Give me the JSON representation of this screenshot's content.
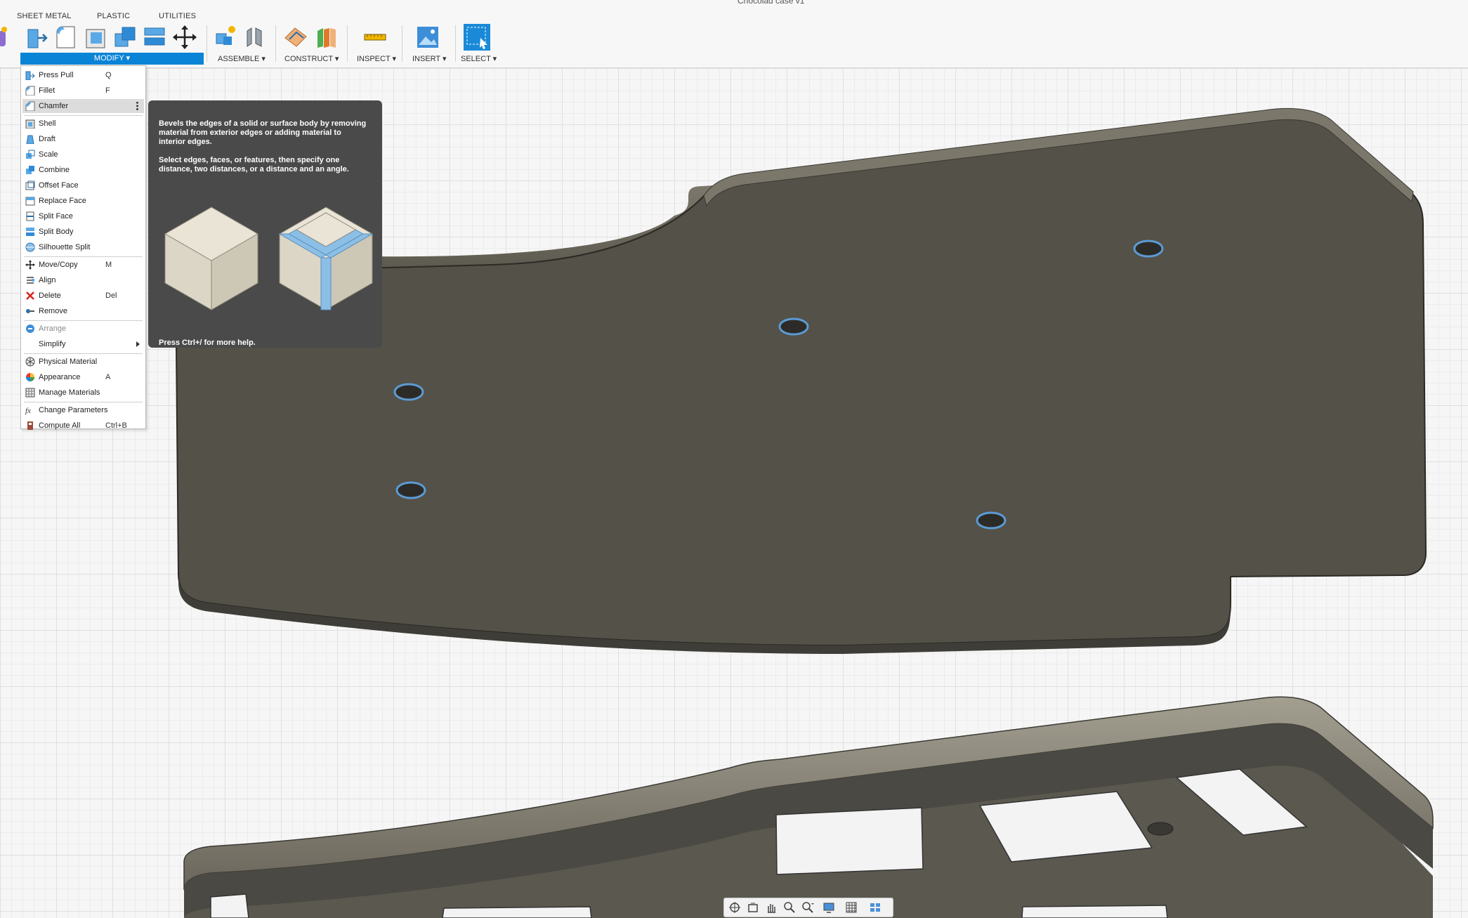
{
  "window": {
    "title": "Chocolad case v1"
  },
  "ribbon": {
    "tabs": [
      "SHEET METAL",
      "PLASTIC",
      "UTILITIES"
    ],
    "groups": {
      "modify": "MODIFY ▾",
      "assemble": "ASSEMBLE ▾",
      "construct": "CONSTRUCT ▾",
      "inspect": "INSPECT ▾",
      "insert": "INSERT ▾",
      "select": "SELECT ▾"
    },
    "tool_icons": [
      "press-pull-icon",
      "fillet-icon",
      "shell-icon",
      "combine-icon",
      "split-icon",
      "move-icon",
      "new-component-icon",
      "joint-icon",
      "offset-plane-icon",
      "midplane-icon",
      "measure-icon",
      "insert-image-icon",
      "select-window-icon"
    ]
  },
  "modify_menu": {
    "items": [
      {
        "label": "Press Pull",
        "key": "Q",
        "icon": "press-pull-icon"
      },
      {
        "label": "Fillet",
        "key": "F",
        "icon": "fillet-icon"
      },
      {
        "label": "Chamfer",
        "key": "",
        "icon": "chamfer-icon"
      },
      {
        "label": "Shell",
        "key": "",
        "icon": "shell-icon"
      },
      {
        "label": "Draft",
        "key": "",
        "icon": "draft-icon"
      },
      {
        "label": "Scale",
        "key": "",
        "icon": "scale-icon"
      },
      {
        "label": "Combine",
        "key": "",
        "icon": "combine-icon"
      },
      {
        "label": "Offset Face",
        "key": "",
        "icon": "offset-face-icon"
      },
      {
        "label": "Replace Face",
        "key": "",
        "icon": "replace-face-icon"
      },
      {
        "label": "Split Face",
        "key": "",
        "icon": "split-face-icon"
      },
      {
        "label": "Split Body",
        "key": "",
        "icon": "split-body-icon"
      },
      {
        "label": "Silhouette Split",
        "key": "",
        "icon": "silhouette-split-icon"
      },
      {
        "label": "Move/Copy",
        "key": "M",
        "icon": "move-copy-icon"
      },
      {
        "label": "Align",
        "key": "",
        "icon": "align-icon"
      },
      {
        "label": "Delete",
        "key": "Del",
        "icon": "delete-icon"
      },
      {
        "label": "Remove",
        "key": "",
        "icon": "remove-icon"
      },
      {
        "label": "Arrange",
        "key": "",
        "icon": "arrange-icon"
      },
      {
        "label": "Simplify",
        "key": "",
        "icon": "simplify-icon"
      },
      {
        "label": "Physical Material",
        "key": "",
        "icon": "physical-material-icon"
      },
      {
        "label": "Appearance",
        "key": "A",
        "icon": "appearance-icon"
      },
      {
        "label": "Manage Materials",
        "key": "",
        "icon": "manage-materials-icon"
      },
      {
        "label": "Change Parameters",
        "key": "",
        "icon": "change-parameters-icon"
      },
      {
        "label": "Compute All",
        "key": "Ctrl+B",
        "icon": "compute-all-icon"
      }
    ],
    "highlighted": "Chamfer",
    "disabled": [
      "Arrange"
    ]
  },
  "tooltip": {
    "paragraph1": "Bevels the edges of a solid or surface body by removing material from exterior edges or adding material to interior edges.",
    "paragraph2": "Select edges, faces, or features, then specify one distance, two distances, or a distance and an angle.",
    "footer": "Press Ctrl+/ for more help."
  },
  "navbar": {
    "icons": [
      "orbit-icon",
      "look-at-icon",
      "pan-icon",
      "zoom-icon",
      "fit-icon",
      "display-settings-icon",
      "grid-icon",
      "viewports-icon"
    ]
  },
  "colors": {
    "accent": "#0a84d6",
    "plate_top": "#545149",
    "plate_edge": "#6e6a5f",
    "tooltip_bg": "#4a4a4a",
    "hole_ring": "#5b9bd5"
  }
}
